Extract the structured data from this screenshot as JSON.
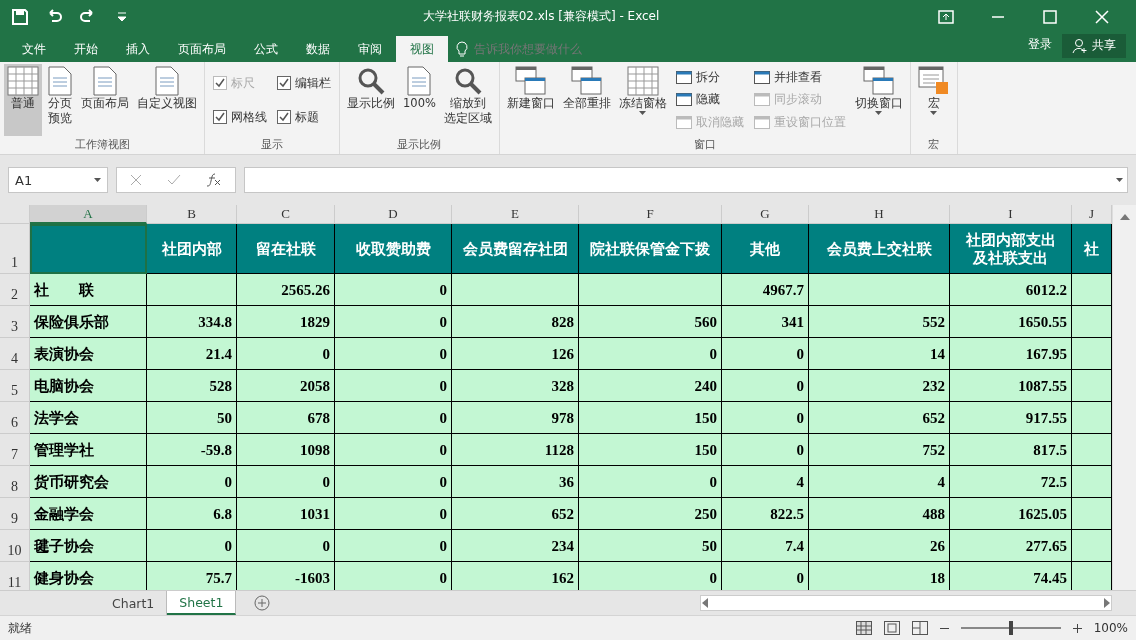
{
  "title_bar": {
    "title": "大学社联财务报表02.xls  [兼容模式] - Excel"
  },
  "menu_tabs": [
    {
      "label": "文件",
      "selected": false
    },
    {
      "label": "开始",
      "selected": false
    },
    {
      "label": "插入",
      "selected": false
    },
    {
      "label": "页面布局",
      "selected": false
    },
    {
      "label": "公式",
      "selected": false
    },
    {
      "label": "数据",
      "selected": false
    },
    {
      "label": "审阅",
      "selected": false
    },
    {
      "label": "视图",
      "selected": true
    }
  ],
  "tell_me": {
    "placeholder": "告诉我你想要做什么"
  },
  "login": "登录",
  "share": "共享",
  "ribbon": [
    {
      "label": "工作簿视图",
      "items": [
        {
          "kind": "large",
          "label": "普通",
          "selected": true
        },
        {
          "kind": "large",
          "label": [
            "分页",
            "预览"
          ],
          "selected": false
        },
        {
          "kind": "large",
          "label": "页面布局",
          "selected": false
        },
        {
          "kind": "large",
          "label": "自定义视图",
          "selected": false
        }
      ]
    },
    {
      "label": "显示",
      "items": [
        {
          "kind": "stack",
          "items": [
            {
              "kind": "check",
              "label": "标尺",
              "checked": true,
              "disabled": true
            },
            {
              "kind": "check",
              "label": "网格线",
              "checked": true,
              "disabled": false
            }
          ]
        },
        {
          "kind": "stack",
          "items": [
            {
              "kind": "check",
              "label": "编辑栏",
              "checked": true,
              "disabled": false
            },
            {
              "kind": "check",
              "label": "标题",
              "checked": true,
              "disabled": false
            }
          ]
        }
      ]
    },
    {
      "label": "显示比例",
      "items": [
        {
          "kind": "large",
          "label": "显示比例"
        },
        {
          "kind": "large",
          "label": "100%"
        },
        {
          "kind": "large",
          "label": [
            "缩放到",
            "选定区域"
          ]
        }
      ]
    },
    {
      "label": "窗口",
      "items": [
        {
          "kind": "large",
          "label": "新建窗口"
        },
        {
          "kind": "large",
          "label": "全部重排"
        },
        {
          "kind": "large",
          "label": "冻结窗格",
          "dropdown": true
        },
        {
          "kind": "stack",
          "items": [
            {
              "kind": "small",
              "label": "拆分",
              "disabled": false
            },
            {
              "kind": "small",
              "label": "隐藏",
              "disabled": false
            },
            {
              "kind": "small",
              "label": "取消隐藏",
              "disabled": true
            }
          ]
        },
        {
          "kind": "stack",
          "items": [
            {
              "kind": "small",
              "label": "并排查看",
              "disabled": false
            },
            {
              "kind": "small",
              "label": "同步滚动",
              "disabled": true
            },
            {
              "kind": "small",
              "label": "重设窗口位置",
              "disabled": true
            }
          ]
        },
        {
          "kind": "large",
          "label": "切换窗口",
          "dropdown": true
        }
      ]
    },
    {
      "label": "宏",
      "items": [
        {
          "kind": "large",
          "label": "宏",
          "dropdown": true
        }
      ]
    }
  ],
  "name_box": "A1",
  "sheet": {
    "columns": [
      {
        "label": "A",
        "selected": true
      },
      {
        "label": "B",
        "selected": false
      },
      {
        "label": "C",
        "selected": false
      },
      {
        "label": "D",
        "selected": false
      },
      {
        "label": "E",
        "selected": false
      },
      {
        "label": "F",
        "selected": false
      },
      {
        "label": "G",
        "selected": false
      },
      {
        "label": "H",
        "selected": false
      },
      {
        "label": "I",
        "selected": false
      },
      {
        "label": "J",
        "selected": false
      }
    ],
    "rows": [
      {
        "number": "1",
        "kind": "header",
        "cells": [
          "",
          "社团内部",
          "留在社联",
          "收取赞助费",
          "会员费留存社团",
          "院社联保管金下拨",
          "其他",
          "会员费上交社联",
          [
            "社团内部支出",
            "及社联支出"
          ],
          "社"
        ]
      },
      {
        "number": "2",
        "kind": "data",
        "cells": [
          "社　　联",
          "",
          "2565.26",
          "0",
          "",
          "",
          "4967.7",
          "",
          "6012.2",
          ""
        ]
      },
      {
        "number": "3",
        "kind": "data",
        "cells": [
          "保险俱乐部",
          "334.8",
          "1829",
          "0",
          "828",
          "560",
          "341",
          "552",
          "1650.55",
          ""
        ]
      },
      {
        "number": "4",
        "kind": "data",
        "cells": [
          "表演协会",
          "21.4",
          "0",
          "0",
          "126",
          "0",
          "0",
          "14",
          "167.95",
          ""
        ]
      },
      {
        "number": "5",
        "kind": "data",
        "cells": [
          "电脑协会",
          "528",
          "2058",
          "0",
          "328",
          "240",
          "0",
          "232",
          "1087.55",
          ""
        ]
      },
      {
        "number": "6",
        "kind": "data",
        "cells": [
          "法学会",
          "50",
          "678",
          "0",
          "978",
          "150",
          "0",
          "652",
          "917.55",
          ""
        ]
      },
      {
        "number": "7",
        "kind": "data",
        "cells": [
          "管理学社",
          "-59.8",
          "1098",
          "0",
          "1128",
          "150",
          "0",
          "752",
          "817.5",
          ""
        ]
      },
      {
        "number": "8",
        "kind": "data",
        "cells": [
          "货币研究会",
          "0",
          "0",
          "0",
          "36",
          "0",
          "4",
          "4",
          "72.5",
          ""
        ]
      },
      {
        "number": "9",
        "kind": "data",
        "cells": [
          "金融学会",
          "6.8",
          "1031",
          "0",
          "652",
          "250",
          "822.5",
          "488",
          "1625.05",
          ""
        ]
      },
      {
        "number": "10",
        "kind": "data",
        "cells": [
          "毽子协会",
          "0",
          "0",
          "0",
          "234",
          "50",
          "7.4",
          "26",
          "277.65",
          ""
        ]
      },
      {
        "number": "11",
        "kind": "data",
        "cells": [
          "健身协会",
          "75.7",
          "-1603",
          "0",
          "162",
          "0",
          "0",
          "18",
          "74.45",
          ""
        ]
      }
    ]
  },
  "sheet_tabs": [
    {
      "label": "Chart1",
      "selected": false
    },
    {
      "label": "Sheet1",
      "selected": true
    }
  ],
  "status": "就绪",
  "zoom": {
    "level": 0.5,
    "reading": "100%"
  }
}
